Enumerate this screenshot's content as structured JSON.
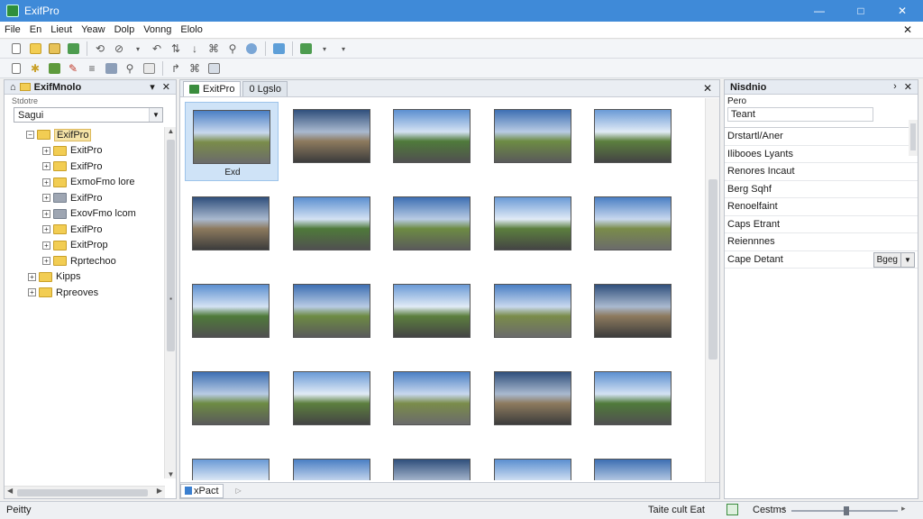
{
  "window": {
    "title": "ExifPro",
    "controls": {
      "minimize": "—",
      "maximize": "□",
      "close": "✕"
    }
  },
  "menu": {
    "items": [
      "File",
      "En",
      "Lieut",
      "Yeaw",
      "Dolp",
      "Vonng",
      "Elolo"
    ],
    "close": "✕"
  },
  "left_panel": {
    "title": "ExifMnolo",
    "sublabel": "Stdotre",
    "search_text": "Sagui",
    "tree": [
      {
        "label": "ExifPro",
        "level": 0,
        "selected": true
      },
      {
        "label": "ExitPro",
        "level": 1
      },
      {
        "label": "ExifPro",
        "level": 1
      },
      {
        "label": "ExmoFmo lore",
        "level": 1
      },
      {
        "label": "ExifPro",
        "level": 1,
        "grey": true
      },
      {
        "label": "ExovFmo lcom",
        "level": 1,
        "grey": true
      },
      {
        "label": "ExifPro",
        "level": 1
      },
      {
        "label": "ExitProp",
        "level": 1
      },
      {
        "label": "Rprtechoo",
        "level": 1
      },
      {
        "label": "Kipps",
        "level": 0
      },
      {
        "label": "Rpreoves",
        "level": 0
      }
    ]
  },
  "center_panel": {
    "tabs": [
      {
        "label": "ExitPro",
        "active": true
      },
      {
        "label": "0 Lgslo",
        "active": false
      }
    ],
    "close": "✕",
    "selected_caption": "Exd",
    "bottom_tab": "xPact",
    "bottom_more": "▷"
  },
  "right_panel": {
    "title": "Nisdnio",
    "label": "Pero",
    "input_value": "Teant",
    "properties": [
      {
        "label": "Drstartl/Aner"
      },
      {
        "label": "Ilibooes Lyants"
      },
      {
        "label": "Renores Incaut"
      },
      {
        "label": "Berg Sqhf"
      },
      {
        "label": "Renoelfaint"
      },
      {
        "label": "Caps Etrant"
      },
      {
        "label": "Reiennnes"
      },
      {
        "label": "Cape Detant",
        "button": "Bgeg"
      }
    ]
  },
  "statusbar": {
    "left": "Peitty",
    "middle": "Taite cult Eat",
    "right_label": "Cestms"
  },
  "colors": {
    "accent": "#3f8ad8",
    "selection": "#cfe3f7"
  }
}
